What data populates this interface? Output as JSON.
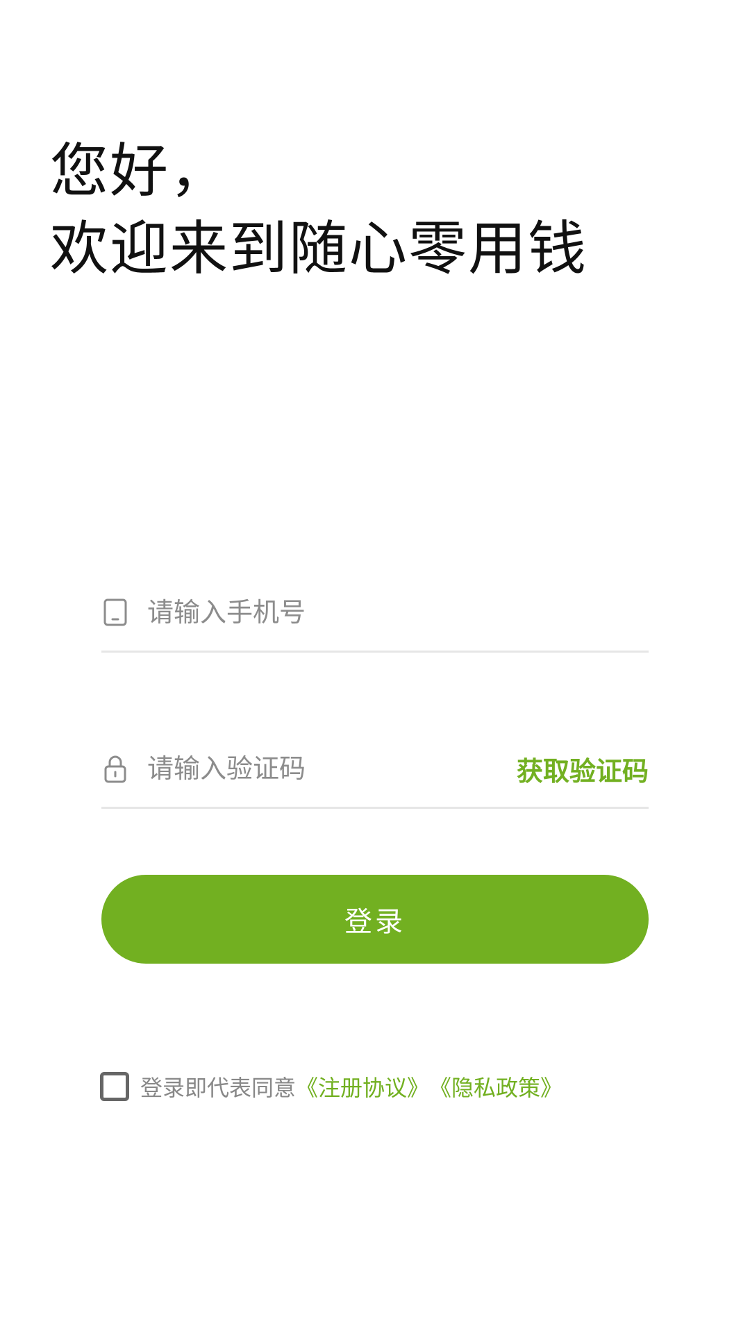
{
  "greeting": {
    "line1": "您好，",
    "line2": "欢迎来到随心零用钱"
  },
  "phone_field": {
    "icon": "phone-icon",
    "placeholder": "请输入手机号",
    "value": ""
  },
  "code_field": {
    "icon": "lock-icon",
    "placeholder": "请输入验证码",
    "value": "",
    "get_code_label": "获取验证码"
  },
  "login_button": {
    "label": "登录"
  },
  "agreement": {
    "checked": false,
    "text": "登录即代表同意",
    "link_register": "《注册协议》",
    "link_privacy": "《隐私政策》"
  },
  "colors": {
    "accent": "#72b021",
    "placeholder": "#8c8c8c",
    "divider": "#e6e6e6"
  }
}
